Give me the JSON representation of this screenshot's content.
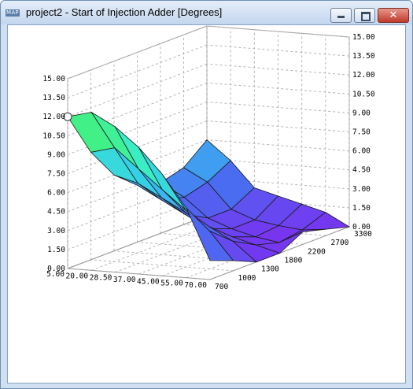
{
  "window": {
    "app_icon_label": "MAP",
    "title": "project2 - Start of Injection Adder [Degrees]",
    "minimize_icon": "minimize-icon",
    "maximize_icon": "maximize-icon",
    "close_icon": "close-icon",
    "close_glyph": "✕",
    "close_color": "#c0392b"
  },
  "chart_data": {
    "type": "surface3d",
    "title": "",
    "z_axis": {
      "ticks": [
        "15.00",
        "13.50",
        "12.00",
        "10.50",
        "9.00",
        "7.50",
        "6.00",
        "4.50",
        "3.00",
        "1.50",
        "0.00"
      ],
      "range": [
        0,
        15
      ]
    },
    "load_axis": {
      "ticks": [
        "5.00",
        "20.00",
        "28.50",
        "37.00",
        "45.00",
        "55.00",
        "70.00"
      ]
    },
    "rpm_axis": {
      "ticks": [
        "700",
        "1000",
        "1300",
        "1800",
        "2200",
        "2700",
        "3300"
      ]
    },
    "grid": true,
    "colormap": [
      "#7b2ff0",
      "#4a6cf0",
      "#35c8f0",
      "#3af0c0",
      "#4af050",
      "#c8ff30"
    ],
    "z": [
      [
        1.5,
        0.8,
        0.0,
        0.0,
        1.0,
        0.5,
        0.0
      ],
      [
        5.5,
        3.0,
        1.5,
        0.5,
        0.0,
        0.3,
        1.0
      ],
      [
        8.0,
        4.5,
        2.5,
        1.0,
        0.3,
        0.5,
        1.5
      ],
      [
        10.0,
        6.0,
        3.5,
        1.5,
        0.8,
        0.8,
        2.0
      ],
      [
        11.5,
        7.5,
        4.5,
        2.5,
        1.5,
        1.5,
        2.5
      ],
      [
        12.5,
        9.0,
        5.5,
        3.5,
        3.0,
        3.5,
        4.5
      ],
      [
        12.0,
        8.5,
        6.0,
        4.5,
        4.0,
        4.5,
        6.0
      ]
    ],
    "marker": {
      "load_index": 6,
      "rpm_index": 0
    }
  }
}
